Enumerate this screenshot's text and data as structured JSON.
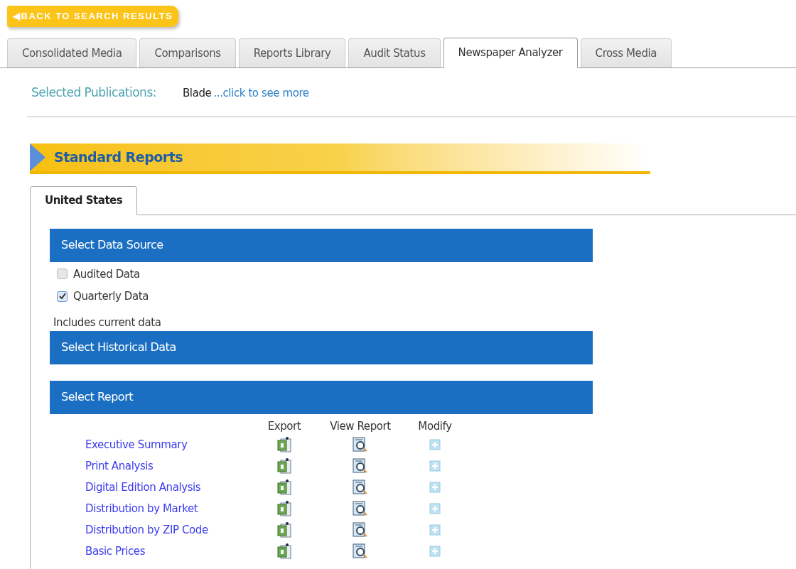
{
  "back_button": {
    "label": "◀BACK TO SEARCH RESULTS"
  },
  "tabs": [
    {
      "label": "Consolidated Media",
      "selected": false
    },
    {
      "label": "Comparisons",
      "selected": false
    },
    {
      "label": "Reports Library",
      "selected": false
    },
    {
      "label": "Audit Status",
      "selected": false
    },
    {
      "label": "Newspaper Analyzer",
      "selected": true
    },
    {
      "label": "Cross Media",
      "selected": false
    }
  ],
  "selected_publications": {
    "label": "Selected Publications:",
    "value": "Blade",
    "link": "...click to see more"
  },
  "section_title": "Standard Reports",
  "region_tabs": [
    {
      "label": "United States",
      "selected": true
    }
  ],
  "data_source": {
    "title": "Select Data Source",
    "options": [
      {
        "label": "Audited Data",
        "checked": false
      },
      {
        "label": "Quarterly Data",
        "checked": true
      }
    ],
    "note": "Includes current data"
  },
  "historical": {
    "title": "Select Historical Data"
  },
  "report": {
    "title": "Select Report",
    "columns": [
      "Export",
      "View Report",
      "Modify"
    ],
    "rows": [
      {
        "name": "Executive Summary"
      },
      {
        "name": "Print Analysis"
      },
      {
        "name": "Digital Edition Analysis"
      },
      {
        "name": "Distribution by Market"
      },
      {
        "name": "Distribution by ZIP Code"
      },
      {
        "name": "Basic Prices"
      }
    ]
  }
}
